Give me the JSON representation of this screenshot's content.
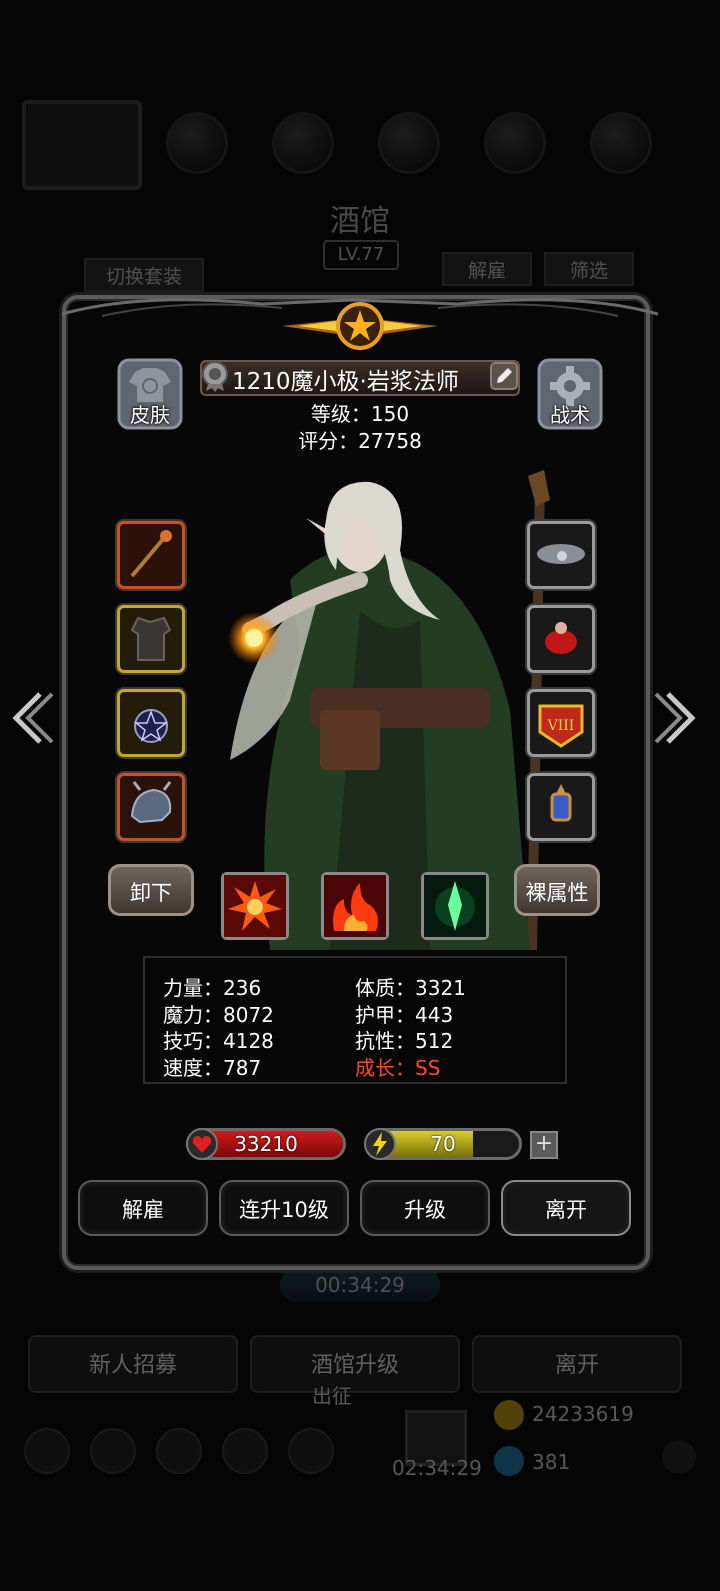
{
  "background": {
    "title": "酒馆",
    "level": "LV.77",
    "switch_outfit": "切换套装",
    "dismiss": "解雇",
    "filter": "筛选",
    "timer": "00:34:29",
    "tabs": [
      "新人招募",
      "酒馆升级",
      "离开"
    ],
    "expedition": "出征",
    "gold": "24233619",
    "bottom_timer": "02:34:29",
    "gems": "381"
  },
  "hero": {
    "name": "1210魔小极·岩浆法师",
    "level_line": "等级：150",
    "score_line": "评分：27758"
  },
  "buttons": {
    "skin": "皮肤",
    "tactics": "战术",
    "unequip": "卸下",
    "base_attributes": "裸属性"
  },
  "equipment": {
    "left": [
      {
        "icon": "staff-icon",
        "rarity": "orange"
      },
      {
        "icon": "armor-icon",
        "rarity": "gold"
      },
      {
        "icon": "pentagram-amulet-icon",
        "rarity": "gold"
      },
      {
        "icon": "dragon-helmet-icon",
        "rarity": "orange"
      }
    ],
    "right": [
      {
        "icon": "storm-cloud-icon",
        "rarity": "gray"
      },
      {
        "icon": "red-gem-ring-icon",
        "rarity": "gray"
      },
      {
        "icon": "viii-badge-icon",
        "rarity": "gray"
      },
      {
        "icon": "lantern-icon",
        "rarity": "gray"
      }
    ]
  },
  "skills": [
    "explosion-skill-icon",
    "fire-skill-icon",
    "green-crystal-skill-icon"
  ],
  "stats": {
    "strength": "力量：236",
    "constitution": "体质：3321",
    "magic": "魔力：8072",
    "armor": "护甲：443",
    "skill": "技巧：4128",
    "resistance": "抗性：512",
    "speed": "速度：787",
    "growth": "成长：SS"
  },
  "bars": {
    "hp": "33210",
    "hp_fraction": 1.0,
    "energy": "70",
    "energy_fraction": 0.7,
    "plus": "+"
  },
  "actions": {
    "dismiss": "解雇",
    "level_up_10": "连升10级",
    "level_up": "升级",
    "leave": "离开"
  },
  "colors": {
    "hp": "#d21a1a",
    "energy": "#d8cd2a",
    "growth": "#ff4a1e"
  }
}
